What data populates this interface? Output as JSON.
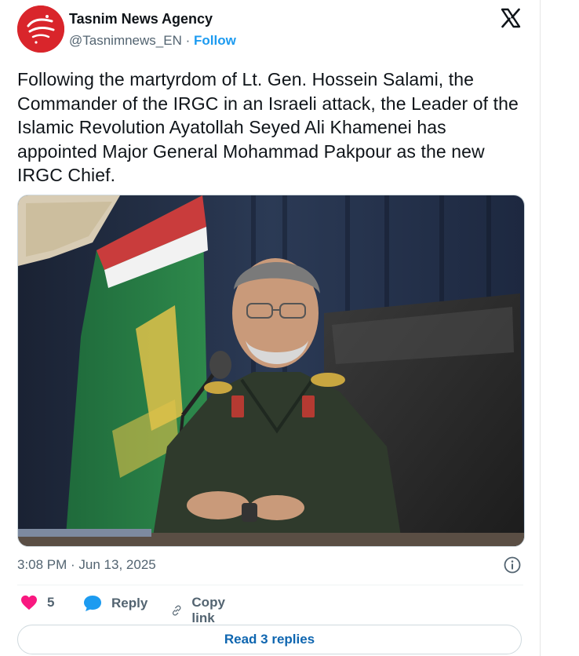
{
  "author": {
    "name": "Tasnim News Agency",
    "handle": "@Tasnimnews_EN",
    "separator": "·",
    "follow_label": "Follow",
    "avatar_icon": "tasnim-logo",
    "avatar_color": "#d9252b"
  },
  "platform_icon": "x-logo-icon",
  "tweet": {
    "text": "Following the martyrdom of Lt. Gen. Hossein Salami, the Commander of the IRGC in an Israeli attack, the Leader of the Islamic Revolution Ayatollah Seyed Ali Khamenei has appointed Major General Mohammad Pakpour as the new IRGC Chief."
  },
  "media": {
    "icon": "photo"
  },
  "meta": {
    "timestamp": "3:08 PM · Jun 13, 2025",
    "info_icon": "info-icon"
  },
  "actions": {
    "like_count": "5",
    "like_icon": "heart-icon",
    "like_color": "#f91880",
    "reply_label": "Reply",
    "reply_icon": "speech-bubble-icon",
    "reply_color": "#1d9bf0",
    "copy_label": "Copy link",
    "copy_icon": "link-icon"
  },
  "read_replies_label": "Read 3 replies",
  "colors": {
    "accent": "#1d9bf0",
    "text": "#0f1419",
    "muted": "#536471"
  }
}
